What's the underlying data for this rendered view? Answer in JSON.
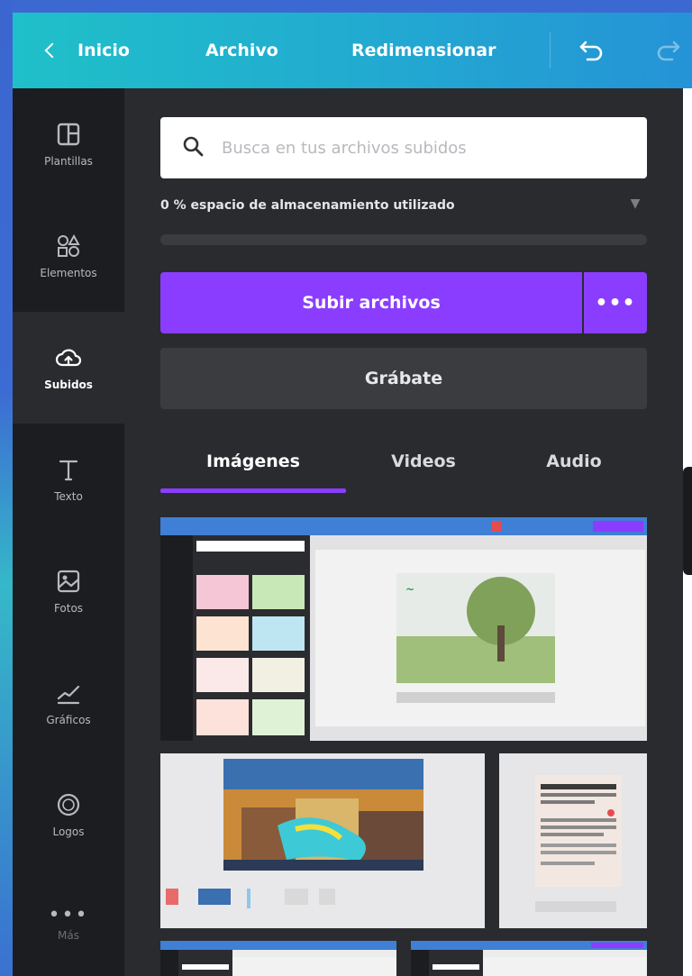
{
  "topbar": {
    "back_label": "Inicio",
    "file_label": "Archivo",
    "resize_label": "Redimensionar"
  },
  "sidebar": {
    "items": [
      {
        "label": "Plantillas",
        "icon": "template-icon"
      },
      {
        "label": "Elementos",
        "icon": "shapes-icon"
      },
      {
        "label": "Subidos",
        "icon": "cloud-upload-icon"
      },
      {
        "label": "Texto",
        "icon": "text-icon"
      },
      {
        "label": "Fotos",
        "icon": "photo-icon"
      },
      {
        "label": "Gráficos",
        "icon": "chart-icon"
      },
      {
        "label": "Logos",
        "icon": "logo-icon"
      },
      {
        "label": "Más",
        "icon": "more-icon"
      }
    ],
    "active_index": 2
  },
  "uploads": {
    "search_placeholder": "Busca en tus archivos subidos",
    "storage_text": "0 % espacio de almacenamiento utilizado",
    "storage_percent": 0,
    "upload_label": "Subir archivos",
    "upload_more_label": "•••",
    "record_label": "Grábate",
    "tabs": [
      "Imágenes",
      "Videos",
      "Audio"
    ],
    "active_tab": "Imágenes"
  },
  "colors": {
    "accent": "#8b3dff",
    "topbar_start": "#1fc0c9",
    "topbar_end": "#2593d6",
    "panel_bg": "#292b2e",
    "sidebar_bg": "#1c1d20"
  }
}
